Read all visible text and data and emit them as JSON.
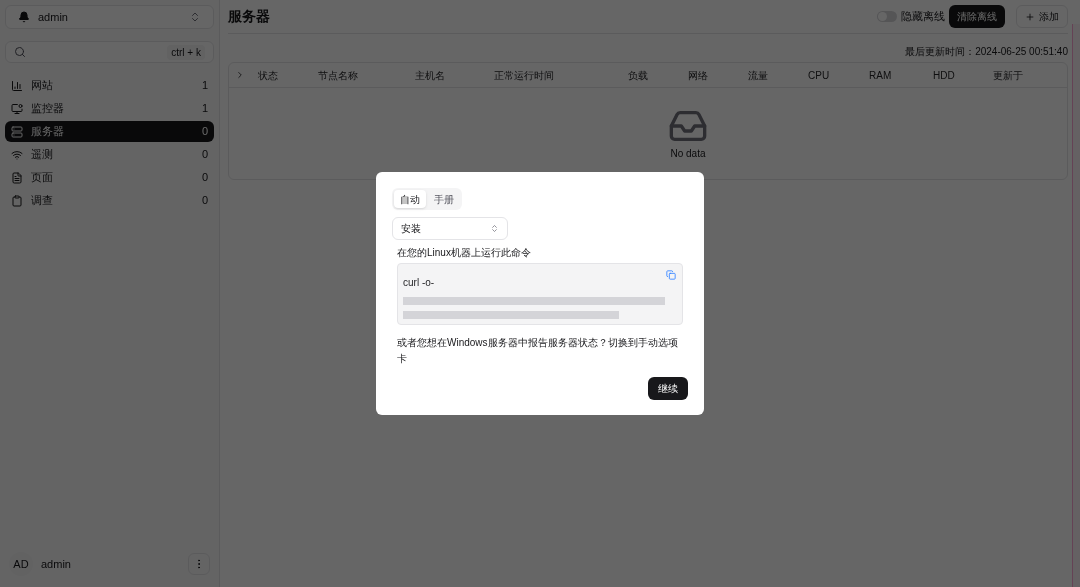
{
  "sidebar": {
    "account": "admin",
    "search": {
      "shortcut": "ctrl + k"
    },
    "items": [
      {
        "label": "网站",
        "count": "1",
        "selected": false
      },
      {
        "label": "监控器",
        "count": "1",
        "selected": false
      },
      {
        "label": "服务器",
        "count": "0",
        "selected": true
      },
      {
        "label": "遥测",
        "count": "0",
        "selected": false
      },
      {
        "label": "页面",
        "count": "0",
        "selected": false
      },
      {
        "label": "调查",
        "count": "0",
        "selected": false
      }
    ],
    "user": {
      "initials": "AD",
      "name": "admin"
    }
  },
  "header": {
    "title": "服务器",
    "hide_offline": {
      "label": "隐藏离线",
      "on": false
    },
    "clear_button": "清除离线",
    "add_button": "添加"
  },
  "last_updated": "最后更新时间：2024-06-25 00:51:40",
  "table": {
    "columns": [
      "状态",
      "节点名称",
      "主机名",
      "正常运行时间",
      "负载",
      "网络",
      "流量",
      "CPU",
      "RAM",
      "HDD",
      "更新于"
    ],
    "empty_text": "No data"
  },
  "dialog": {
    "tabs": [
      {
        "label": "自动",
        "selected": true
      },
      {
        "label": "手册",
        "selected": false
      }
    ],
    "select": "安装",
    "instruction": "在您的Linux机器上运行此命令",
    "command": "curl -o-",
    "note": "或者您想在Windows服务器中报告服务器状态？切换到手动选项卡",
    "continue_button": "继续"
  }
}
